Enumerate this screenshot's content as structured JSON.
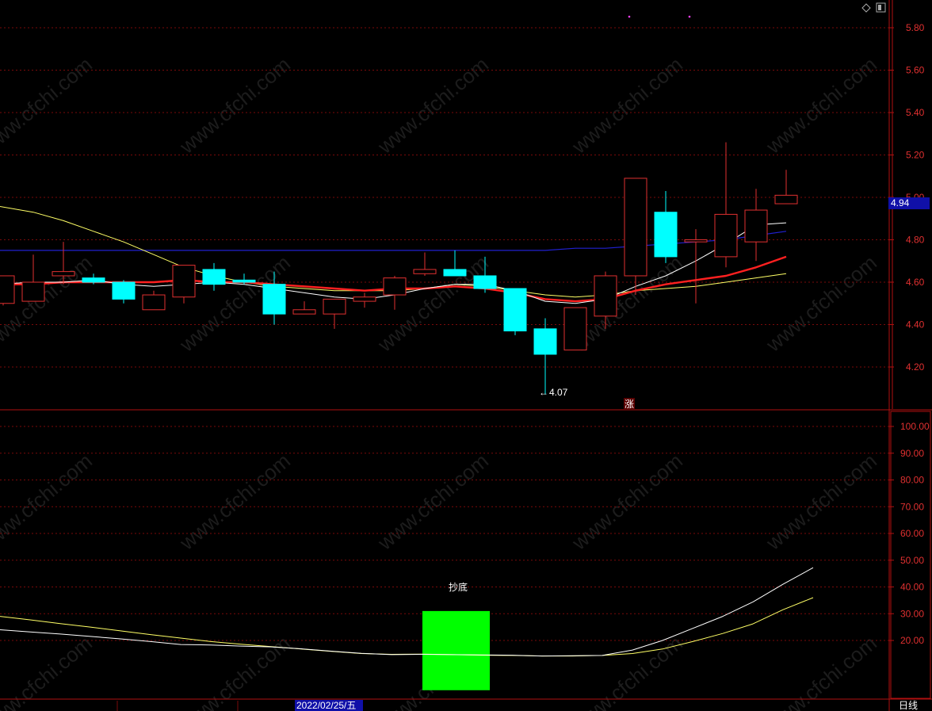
{
  "watermark": "www.cfchi.com",
  "colors": {
    "background": "#000000",
    "grid": "#7a0a0a",
    "up_candle": "#e03030",
    "down_candle": "#00ffff",
    "ma_white": "#ffffff",
    "ma_red": "#ff2020",
    "ma_yellow": "#ffff66",
    "ma_blue": "#2020d0",
    "signal_bar": "#00ff00"
  },
  "chart_data": [
    {
      "type": "candlestick",
      "y_ticks": [
        "5.80",
        "5.60",
        "5.40",
        "5.20",
        "5.00",
        "4.80",
        "4.60",
        "4.40",
        "4.20"
      ],
      "ylim": [
        4.0,
        5.88
      ],
      "current_price_label": "4.94",
      "low_annotation": "4.07",
      "marker_label": "涨",
      "candles": [
        {
          "o": 4.5,
          "h": 4.61,
          "l": 4.49,
          "c": 4.63
        },
        {
          "o": 4.51,
          "h": 4.73,
          "l": 4.51,
          "c": 4.6
        },
        {
          "o": 4.63,
          "h": 4.79,
          "l": 4.59,
          "c": 4.65
        },
        {
          "o": 4.62,
          "h": 4.64,
          "l": 4.59,
          "c": 4.6
        },
        {
          "o": 4.6,
          "h": 4.61,
          "l": 4.5,
          "c": 4.52
        },
        {
          "o": 4.47,
          "h": 4.56,
          "l": 4.47,
          "c": 4.54
        },
        {
          "o": 4.53,
          "h": 4.68,
          "l": 4.5,
          "c": 4.68
        },
        {
          "o": 4.66,
          "h": 4.69,
          "l": 4.56,
          "c": 4.59
        },
        {
          "o": 4.61,
          "h": 4.64,
          "l": 4.59,
          "c": 4.6
        },
        {
          "o": 4.59,
          "h": 4.65,
          "l": 4.4,
          "c": 4.45
        },
        {
          "o": 4.45,
          "h": 4.51,
          "l": 4.45,
          "c": 4.47
        },
        {
          "o": 4.45,
          "h": 4.52,
          "l": 4.38,
          "c": 4.52
        },
        {
          "o": 4.51,
          "h": 4.55,
          "l": 4.48,
          "c": 4.53
        },
        {
          "o": 4.54,
          "h": 4.63,
          "l": 4.47,
          "c": 4.62
        },
        {
          "o": 4.64,
          "h": 4.74,
          "l": 4.63,
          "c": 4.66
        },
        {
          "o": 4.66,
          "h": 4.75,
          "l": 4.63,
          "c": 4.63
        },
        {
          "o": 4.63,
          "h": 4.72,
          "l": 4.55,
          "c": 4.57
        },
        {
          "o": 4.57,
          "h": 4.57,
          "l": 4.35,
          "c": 4.37
        },
        {
          "o": 4.38,
          "h": 4.43,
          "l": 4.07,
          "c": 4.26
        },
        {
          "o": 4.28,
          "h": 4.48,
          "l": 4.28,
          "c": 4.48
        },
        {
          "o": 4.44,
          "h": 4.65,
          "l": 4.38,
          "c": 4.63
        },
        {
          "o": 4.63,
          "h": 5.09,
          "l": 4.54,
          "c": 5.09
        },
        {
          "o": 4.93,
          "h": 5.03,
          "l": 4.69,
          "c": 4.72
        },
        {
          "o": 4.79,
          "h": 4.85,
          "l": 4.5,
          "c": 4.8
        },
        {
          "o": 4.72,
          "h": 5.26,
          "l": 4.67,
          "c": 4.92
        },
        {
          "o": 4.79,
          "h": 5.04,
          "l": 4.7,
          "c": 4.94
        },
        {
          "o": 4.97,
          "h": 5.13,
          "l": 4.97,
          "c": 5.01
        }
      ],
      "ma_white": [
        4.59,
        4.6,
        4.6,
        4.61,
        4.59,
        4.58,
        4.59,
        4.6,
        4.59,
        4.57,
        4.55,
        4.53,
        4.52,
        4.54,
        4.57,
        4.59,
        4.59,
        4.56,
        4.51,
        4.5,
        4.52,
        4.58,
        4.63,
        4.7,
        4.78,
        4.87,
        4.88
      ],
      "ma_red": [
        4.59,
        4.59,
        4.6,
        4.6,
        4.6,
        4.6,
        4.61,
        4.6,
        4.6,
        4.59,
        4.58,
        4.57,
        4.56,
        4.57,
        4.57,
        4.58,
        4.57,
        4.55,
        4.52,
        4.51,
        4.52,
        4.56,
        4.59,
        4.61,
        4.63,
        4.67,
        4.72
      ],
      "ma_yellow": [
        4.96,
        4.93,
        4.89,
        4.84,
        4.79,
        4.73,
        4.67,
        4.63,
        4.6,
        4.58,
        4.57,
        4.56,
        4.56,
        4.56,
        4.57,
        4.59,
        4.58,
        4.56,
        4.54,
        4.53,
        4.54,
        4.56,
        4.57,
        4.58,
        4.6,
        4.62,
        4.64
      ],
      "ma_blue": [
        4.75,
        4.75,
        4.75,
        4.75,
        4.75,
        4.75,
        4.75,
        4.75,
        4.75,
        4.75,
        4.75,
        4.75,
        4.75,
        4.75,
        4.75,
        4.75,
        4.75,
        4.75,
        4.75,
        4.76,
        4.76,
        4.77,
        4.78,
        4.79,
        4.8,
        4.82,
        4.84
      ]
    },
    {
      "type": "indicator",
      "y_ticks": [
        "100.00",
        "90.00",
        "80.00",
        "70.00",
        "60.00",
        "50.00",
        "40.00",
        "30.00",
        "20.00"
      ],
      "ylim": [
        0,
        102
      ],
      "signal_label": "抄底",
      "signal_bar": {
        "from_index": 14,
        "to_index": 16,
        "value": 31
      },
      "white_line": [
        24.0,
        23.2,
        22.4,
        21.5,
        20.6,
        19.6,
        18.5,
        18.3,
        17.9,
        17.6,
        16.9,
        16.0,
        15.2,
        14.7,
        14.8,
        14.7,
        14.6,
        14.5,
        14.2,
        14.3,
        14.4,
        16.4,
        20.0,
        24.5,
        29.0,
        34.4,
        41.0,
        47.2
      ],
      "yellow_line": [
        29.0,
        27.7,
        26.3,
        25.0,
        23.6,
        22.2,
        20.9,
        19.6,
        18.6,
        17.7,
        16.8,
        15.9,
        15.1,
        14.8,
        14.9,
        14.7,
        14.5,
        14.4,
        14.2,
        14.2,
        14.4,
        15.1,
        16.8,
        19.6,
        22.6,
        26.2,
        31.5,
        36.0
      ]
    }
  ],
  "footer": {
    "date_label": "2022/02/25/五",
    "period_label": "日线"
  }
}
